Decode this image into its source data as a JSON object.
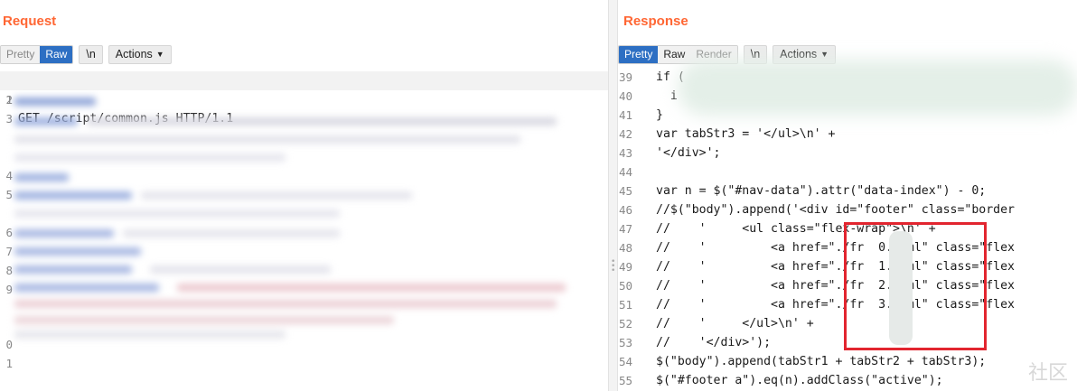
{
  "request": {
    "title": "Request",
    "tabs": [
      "Pretty",
      "Raw",
      "\\n"
    ],
    "actions_label": "Actions",
    "first_line": "GET /script/common.js HTTP/1.1",
    "line_numbers": [
      "1",
      "2",
      "3",
      "4",
      "5",
      "6",
      "7",
      "8",
      "9",
      "0",
      "1"
    ]
  },
  "response": {
    "title": "Response",
    "tabs": [
      "Pretty",
      "Raw",
      "Render",
      "\\n"
    ],
    "actions_label": "Actions",
    "lines": [
      {
        "n": "39",
        "code": "if ("
      },
      {
        "n": "40",
        "code": "  i"
      },
      {
        "n": "41",
        "code": "}"
      },
      {
        "n": "42",
        "code": "var tabStr3 = '</ul>\\n' +"
      },
      {
        "n": "43",
        "code": "'</div>';"
      },
      {
        "n": "44",
        "code": ""
      },
      {
        "n": "45",
        "code": "var n = $(\"#nav-data\").attr(\"data-index\") - 0;"
      },
      {
        "n": "46",
        "code": "//$(\"body\").append('<div id=\"footer\" class=\"border"
      },
      {
        "n": "47",
        "code": "//    '     <ul class=\"flex-wrap\">\\n' +"
      },
      {
        "n": "48",
        "code": "//    '         <a href=\"./fr  0.html\" class=\"flex"
      },
      {
        "n": "49",
        "code": "//    '         <a href=\"./fr  1.html\" class=\"flex"
      },
      {
        "n": "50",
        "code": "//    '         <a href=\"./fr  2.html\" class=\"flex"
      },
      {
        "n": "51",
        "code": "//    '         <a href=\"./fr  3.html\" class=\"flex"
      },
      {
        "n": "52",
        "code": "//    '     </ul>\\n' +"
      },
      {
        "n": "53",
        "code": "//    '</div>');"
      },
      {
        "n": "54",
        "code": "$(\"body\").append(tabStr1 + tabStr2 + tabStr3);"
      },
      {
        "n": "55",
        "code": "$(\"#footer a\").eq(n).addClass(\"active\");"
      }
    ]
  },
  "watermark": "社区"
}
